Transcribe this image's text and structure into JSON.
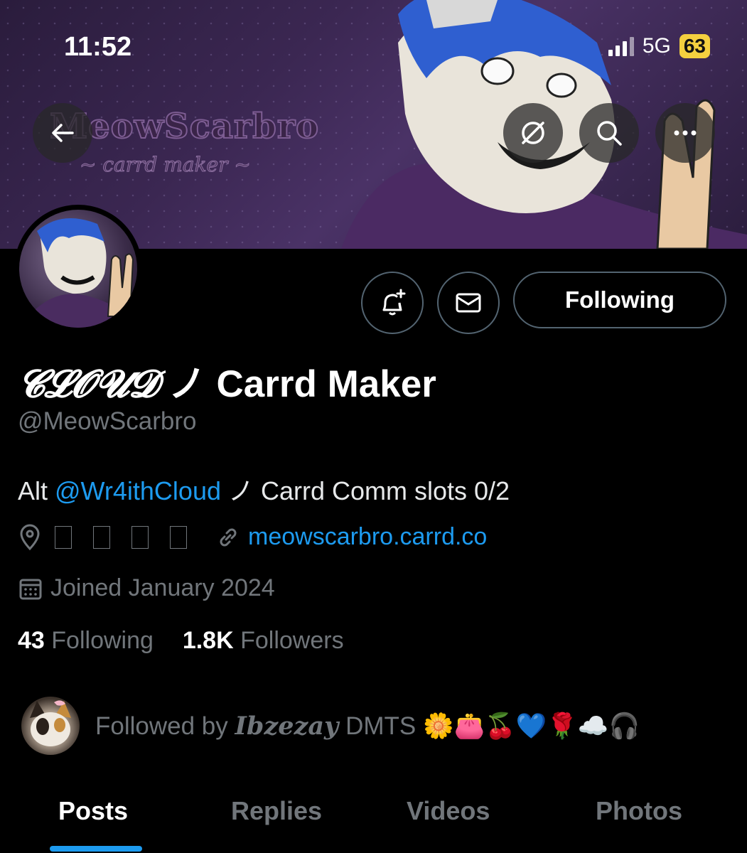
{
  "status_bar": {
    "time": "11:52",
    "network": "5G",
    "battery": "63"
  },
  "banner": {
    "title": "MeowScarbro",
    "subtitle": "~ carrd maker ~"
  },
  "header_icons": [
    "back-arrow-icon",
    "grok-icon",
    "search-icon",
    "more-icon"
  ],
  "actions": {
    "follow_label": "Following"
  },
  "profile": {
    "display_name_fancy": "𝓒𝓛𝓞𝓤𝓓",
    "display_name_rest": " ノ Carrd Maker",
    "handle": "@MeowScarbro",
    "bio_prefix": "Alt ",
    "bio_mention": "@Wr4ithCloud",
    "bio_suffix": " ノ Carrd Comm slots 0/2",
    "website": "meowscarbro.carrd.co",
    "joined": "Joined January 2024",
    "following_count": "43",
    "following_label": "Following",
    "followers_count": "1.8K",
    "followers_label": "Followers"
  },
  "followed_by": {
    "prefix": "Followed by ",
    "name_fancy": "𝑰𝒃𝒛𝒆𝒛𝒂𝒚",
    "name_rest": " DMTS ",
    "emojis": "🌼👛🍒💙🌹☁️🎧"
  },
  "tabs": [
    {
      "label": "Posts",
      "active": true
    },
    {
      "label": "Replies",
      "active": false
    },
    {
      "label": "Videos",
      "active": false
    },
    {
      "label": "Photos",
      "active": false
    }
  ],
  "colors": {
    "accent": "#1d9bf0",
    "muted": "#71767b",
    "background": "#000000"
  }
}
